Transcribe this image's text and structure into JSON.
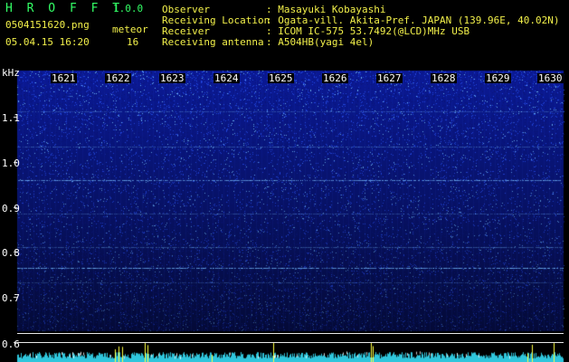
{
  "app": {
    "name": "H R O F F T",
    "version": "1.0.0"
  },
  "file": {
    "name": "0504151620.png",
    "datetime": "05.04.15 16:20"
  },
  "counter": {
    "label": "meteor",
    "value": "16"
  },
  "station": {
    "rows": [
      {
        "label": "Observer",
        "value": ": Masayuki Kobayashi"
      },
      {
        "label": "Receiving Location",
        "value": ": Ogata-vill. Akita-Pref. JAPAN (139.96E, 40.02N)"
      },
      {
        "label": "Receiver",
        "value": ": ICOM IC-575 53.7492(@LCD)MHz USB"
      },
      {
        "label": "Receiving antenna",
        "value": ": A504HB(yagi 4el)"
      }
    ]
  },
  "spectrogram": {
    "unit": "kHz",
    "y_ticks": [
      "1.1",
      "1.0",
      "0.9",
      "0.8",
      "0.7",
      "0.6"
    ],
    "minute_labels": [
      "1621",
      "1622",
      "1623",
      "1624",
      "1625",
      "1626",
      "1627",
      "1628",
      "1629",
      "1630"
    ],
    "colors": {
      "background": "#000000",
      "noise": "#1a2ec8",
      "signal": "#3fa8ff",
      "echo": "#ffff40",
      "waterline": "#30d0e0"
    }
  }
}
